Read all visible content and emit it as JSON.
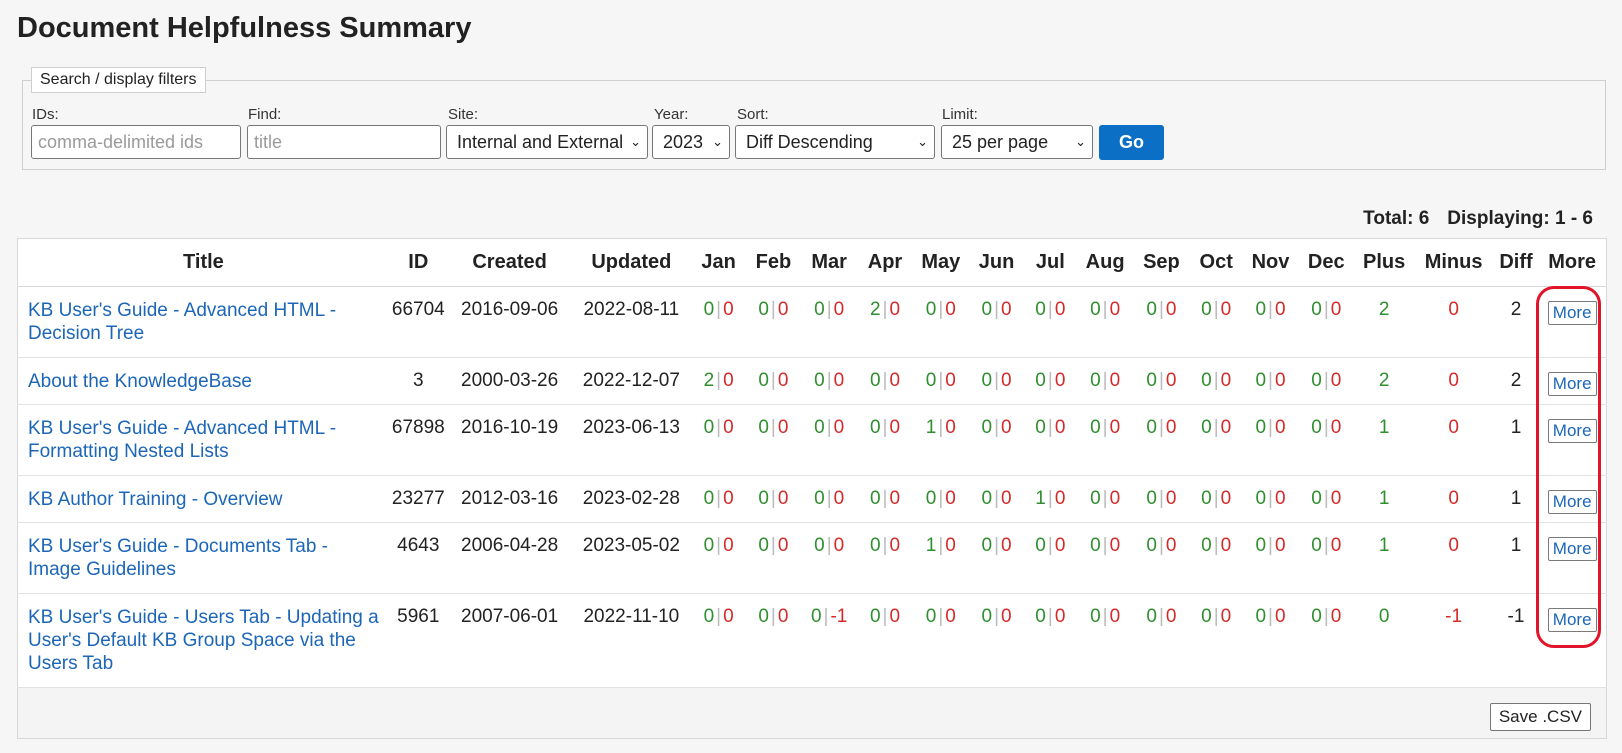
{
  "page": {
    "title": "Document Helpfulness Summary"
  },
  "filters": {
    "legend": "Search / display filters",
    "ids": {
      "label": "IDs:",
      "placeholder": "comma-delimited ids"
    },
    "find": {
      "label": "Find:",
      "placeholder": "title"
    },
    "site": {
      "label": "Site:",
      "value": "Internal and External"
    },
    "year": {
      "label": "Year:",
      "value": "2023"
    },
    "sort": {
      "label": "Sort:",
      "value": "Diff Descending"
    },
    "limit": {
      "label": "Limit:",
      "value": "25 per page"
    },
    "go_label": "Go"
  },
  "summary": {
    "total": "Total: 6",
    "displaying": "Displaying: 1 - 6"
  },
  "table": {
    "headers": [
      "Title",
      "ID",
      "Created",
      "Updated",
      "Jan",
      "Feb",
      "Mar",
      "Apr",
      "May",
      "Jun",
      "Jul",
      "Aug",
      "Sep",
      "Oct",
      "Nov",
      "Dec",
      "Plus",
      "Minus",
      "Diff",
      "More"
    ],
    "rows": [
      {
        "title": "KB User's Guide - Advanced HTML - Decision Tree",
        "id": "66704",
        "created": "2016-09-06",
        "updated": "2022-08-11",
        "months": [
          [
            "0",
            "0"
          ],
          [
            "0",
            "0"
          ],
          [
            "0",
            "0"
          ],
          [
            "2",
            "0"
          ],
          [
            "0",
            "0"
          ],
          [
            "0",
            "0"
          ],
          [
            "0",
            "0"
          ],
          [
            "0",
            "0"
          ],
          [
            "0",
            "0"
          ],
          [
            "0",
            "0"
          ],
          [
            "0",
            "0"
          ],
          [
            "0",
            "0"
          ]
        ],
        "plus": "2",
        "minus": "0",
        "diff": "2",
        "more": "More"
      },
      {
        "title": "About the KnowledgeBase",
        "id": "3",
        "created": "2000-03-26",
        "updated": "2022-12-07",
        "months": [
          [
            "2",
            "0"
          ],
          [
            "0",
            "0"
          ],
          [
            "0",
            "0"
          ],
          [
            "0",
            "0"
          ],
          [
            "0",
            "0"
          ],
          [
            "0",
            "0"
          ],
          [
            "0",
            "0"
          ],
          [
            "0",
            "0"
          ],
          [
            "0",
            "0"
          ],
          [
            "0",
            "0"
          ],
          [
            "0",
            "0"
          ],
          [
            "0",
            "0"
          ]
        ],
        "plus": "2",
        "minus": "0",
        "diff": "2",
        "more": "More"
      },
      {
        "title": "KB User's Guide - Advanced HTML - Formatting Nested Lists",
        "id": "67898",
        "created": "2016-10-19",
        "updated": "2023-06-13",
        "months": [
          [
            "0",
            "0"
          ],
          [
            "0",
            "0"
          ],
          [
            "0",
            "0"
          ],
          [
            "0",
            "0"
          ],
          [
            "1",
            "0"
          ],
          [
            "0",
            "0"
          ],
          [
            "0",
            "0"
          ],
          [
            "0",
            "0"
          ],
          [
            "0",
            "0"
          ],
          [
            "0",
            "0"
          ],
          [
            "0",
            "0"
          ],
          [
            "0",
            "0"
          ]
        ],
        "plus": "1",
        "minus": "0",
        "diff": "1",
        "more": "More"
      },
      {
        "title": "KB Author Training - Overview",
        "id": "23277",
        "created": "2012-03-16",
        "updated": "2023-02-28",
        "months": [
          [
            "0",
            "0"
          ],
          [
            "0",
            "0"
          ],
          [
            "0",
            "0"
          ],
          [
            "0",
            "0"
          ],
          [
            "0",
            "0"
          ],
          [
            "0",
            "0"
          ],
          [
            "1",
            "0"
          ],
          [
            "0",
            "0"
          ],
          [
            "0",
            "0"
          ],
          [
            "0",
            "0"
          ],
          [
            "0",
            "0"
          ],
          [
            "0",
            "0"
          ]
        ],
        "plus": "1",
        "minus": "0",
        "diff": "1",
        "more": "More"
      },
      {
        "title": "KB User's Guide - Documents Tab - Image Guidelines",
        "id": "4643",
        "created": "2006-04-28",
        "updated": "2023-05-02",
        "months": [
          [
            "0",
            "0"
          ],
          [
            "0",
            "0"
          ],
          [
            "0",
            "0"
          ],
          [
            "0",
            "0"
          ],
          [
            "1",
            "0"
          ],
          [
            "0",
            "0"
          ],
          [
            "0",
            "0"
          ],
          [
            "0",
            "0"
          ],
          [
            "0",
            "0"
          ],
          [
            "0",
            "0"
          ],
          [
            "0",
            "0"
          ],
          [
            "0",
            "0"
          ]
        ],
        "plus": "1",
        "minus": "0",
        "diff": "1",
        "more": "More"
      },
      {
        "title": "KB User's Guide - Users Tab - Updating a User's Default KB Group Space via the Users Tab",
        "id": "5961",
        "created": "2007-06-01",
        "updated": "2022-11-10",
        "months": [
          [
            "0",
            "0"
          ],
          [
            "0",
            "0"
          ],
          [
            "0",
            "-1"
          ],
          [
            "0",
            "0"
          ],
          [
            "0",
            "0"
          ],
          [
            "0",
            "0"
          ],
          [
            "0",
            "0"
          ],
          [
            "0",
            "0"
          ],
          [
            "0",
            "0"
          ],
          [
            "0",
            "0"
          ],
          [
            "0",
            "0"
          ],
          [
            "0",
            "0"
          ]
        ],
        "plus": "0",
        "minus": "-1",
        "diff": "-1",
        "more": "More"
      }
    ]
  },
  "footer": {
    "csv_label": "Save .CSV"
  },
  "colors": {
    "link": "#1c66b8",
    "plus": "#2f8f2f",
    "minus": "#d42a2a",
    "go": "#0b6fc5",
    "highlight": "#e0152a"
  }
}
